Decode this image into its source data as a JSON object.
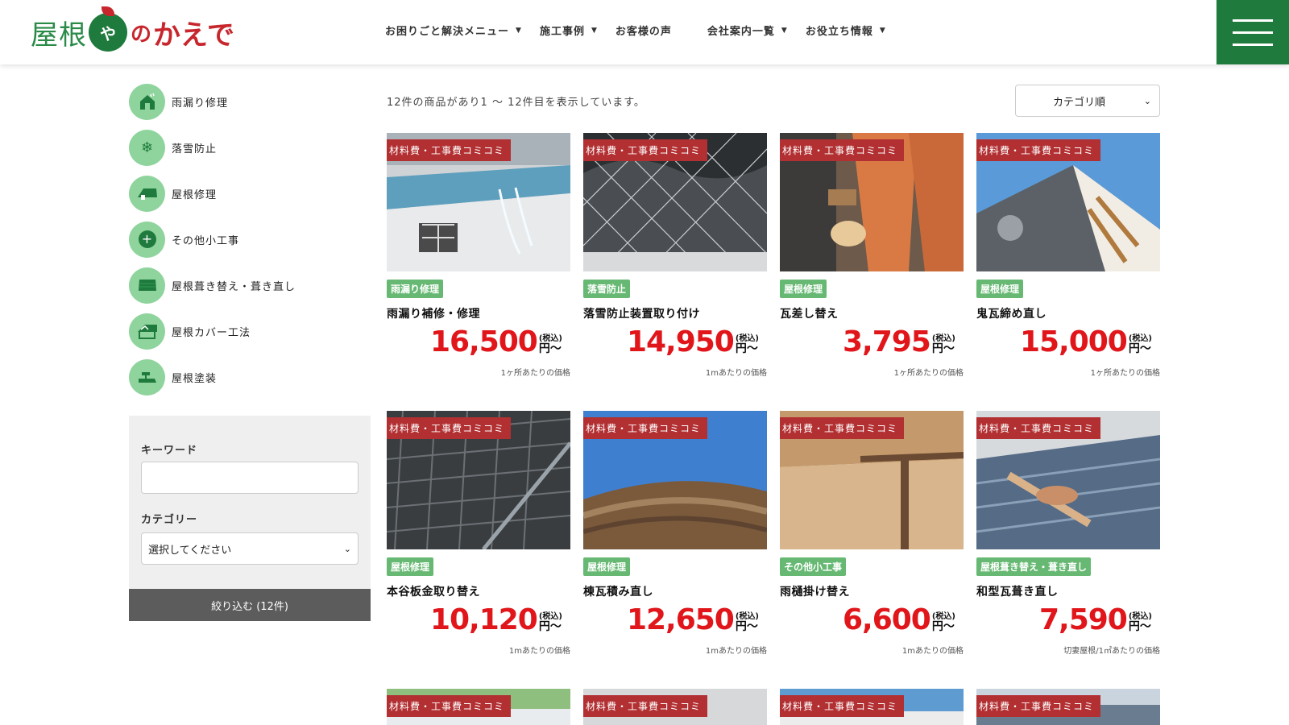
{
  "header": {
    "logo": {
      "part1": "屋根",
      "ball": "や",
      "part2": "の",
      "part3": "かえで"
    },
    "nav": [
      {
        "label": "お困りごと解決メニュー",
        "caret": true
      },
      {
        "label": "施工事例",
        "caret": true
      },
      {
        "label": "お客様の声",
        "caret": false
      },
      {
        "label": "会社案内一覧",
        "caret": true
      },
      {
        "label": "お役立ち情報",
        "caret": true
      }
    ]
  },
  "sidebar": {
    "categories": [
      {
        "label": "雨漏り修理",
        "icon": "house-rain-icon"
      },
      {
        "label": "落雪防止",
        "icon": "snowflake-icon"
      },
      {
        "label": "屋根修理",
        "icon": "roof-icon"
      },
      {
        "label": "その他小工事",
        "icon": "plus-icon"
      },
      {
        "label": "屋根葺き替え・葺き直し",
        "icon": "roof-tiles-icon"
      },
      {
        "label": "屋根カバー工法",
        "icon": "roof-cover-icon"
      },
      {
        "label": "屋根塗装",
        "icon": "paint-icon"
      }
    ],
    "search": {
      "keyword_label": "キーワード",
      "keyword_value": "",
      "category_label": "カテゴリー",
      "category_value": "選択してください",
      "button_label": "絞り込む (12件)"
    }
  },
  "main": {
    "result_text": "12件の商品があり1 〜 12件目を表示しています。",
    "sort_value": "カテゴリ順",
    "products": [
      {
        "tag": "材料費・工事費コミコミ",
        "category": "雨漏り修理",
        "title": "雨漏り補修・修理",
        "price": "16,500",
        "tax": "(税込)",
        "yen": "円〜",
        "unit": "1ヶ所あたりの価格",
        "img": "rain"
      },
      {
        "tag": "材料費・工事費コミコミ",
        "category": "落雪防止",
        "title": "落雪防止装置取り付け",
        "price": "14,950",
        "tax": "(税込)",
        "yen": "円〜",
        "unit": "1mあたりの価格",
        "img": "net"
      },
      {
        "tag": "材料費・工事費コミコミ",
        "category": "屋根修理",
        "title": "瓦差し替え",
        "price": "3,795",
        "tax": "(税込)",
        "yen": "円〜",
        "unit": "1ヶ所あたりの価格",
        "img": "orange"
      },
      {
        "tag": "材料費・工事費コミコミ",
        "category": "屋根修理",
        "title": "鬼瓦締め直し",
        "price": "15,000",
        "tax": "(税込)",
        "yen": "円〜",
        "unit": "1ヶ所あたりの価格",
        "img": "onigawara"
      },
      {
        "tag": "材料費・工事費コミコミ",
        "category": "屋根修理",
        "title": "本谷板金取り替え",
        "price": "10,120",
        "tax": "(税込)",
        "yen": "円〜",
        "unit": "1mあたりの価格",
        "img": "valley"
      },
      {
        "tag": "材料費・工事費コミコミ",
        "category": "屋根修理",
        "title": "棟瓦積み直し",
        "price": "12,650",
        "tax": "(税込)",
        "yen": "円〜",
        "unit": "1mあたりの価格",
        "img": "ridge"
      },
      {
        "tag": "材料費・工事費コミコミ",
        "category": "その他小工事",
        "title": "雨樋掛け替え",
        "price": "6,600",
        "tax": "(税込)",
        "yen": "円〜",
        "unit": "1mあたりの価格",
        "img": "gutter"
      },
      {
        "tag": "材料費・工事費コミコミ",
        "category": "屋根葺き替え・葺き直し",
        "title": "和型瓦葺き直し",
        "price": "7,590",
        "tax": "(税込)",
        "yen": "円〜",
        "unit": "切妻屋根/1㎡あたりの価格",
        "img": "retile"
      }
    ],
    "row3_tags": [
      "材料費・工事費コミコミ",
      "材料費・工事費コミコミ",
      "材料費・工事費コミコミ",
      "材料費・工事費コミコミ"
    ]
  },
  "colors": {
    "brand_green": "#1f7a3d",
    "badge_green": "#66b872",
    "tag_red": "#b22f32",
    "price_red": "#e0161b"
  }
}
